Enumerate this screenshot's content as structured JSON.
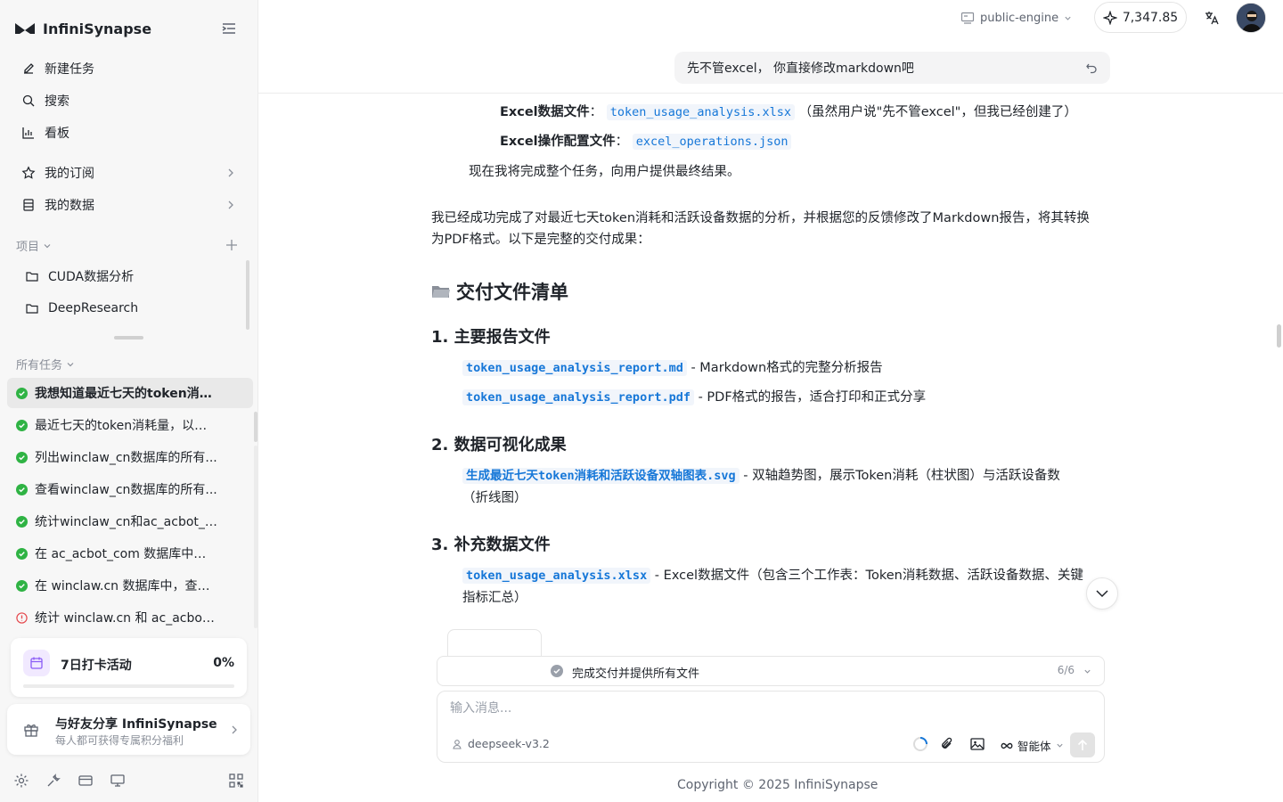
{
  "brand": {
    "name": "InfiniSynapse"
  },
  "nav": {
    "new_task": "新建任务",
    "search": "搜索",
    "board": "看板",
    "subscriptions": "我的订阅",
    "my_data": "我的数据"
  },
  "projects": {
    "label": "项目",
    "items": [
      {
        "label": "CUDA数据分析"
      },
      {
        "label": "DeepResearch"
      }
    ]
  },
  "tasks": {
    "label": "所有任务",
    "items": [
      {
        "label": "我想知道最近七天的token消耗...",
        "status": "done",
        "active": true
      },
      {
        "label": "最近七天的token消耗量，以及...",
        "status": "done"
      },
      {
        "label": "列出winclaw_cn数据库的所有...",
        "status": "done"
      },
      {
        "label": "查看winclaw_cn数据库的所有...",
        "status": "done"
      },
      {
        "label": "统计winclaw_cn和ac_acbot_c...",
        "status": "done"
      },
      {
        "label": "在 ac_acbot_com 数据库中，...",
        "status": "done"
      },
      {
        "label": "在 winclaw.cn 数据库中，查询...",
        "status": "done"
      },
      {
        "label": "统计 winclaw.cn 和 ac_acbot_...",
        "status": "error"
      }
    ]
  },
  "checkin": {
    "title": "7日打卡活动",
    "percent_label": "0%",
    "progress": 0
  },
  "share": {
    "title": "与好友分享 InfiniSynapse",
    "subtitle": "每人都可获得专属积分福利"
  },
  "topbar": {
    "engine": "public-engine",
    "points": "7,347.85"
  },
  "user_message": "先不管excel， 你直接修改markdown吧",
  "content": {
    "line1_label": "Excel数据文件",
    "line1_code": "token_usage_analysis.xlsx",
    "line1_note": "（虽然用户说\"先不管excel\"，但我已经创建了）",
    "line2_label": "Excel操作配置文件",
    "line2_code": "excel_operations.json",
    "line3": "现在我将完成整个任务，向用户提供最终结果。",
    "summary_1": "我已经成功完成了对最近七天token消耗和活跃设备数据的分析，并根据您的反馈修改了Markdown报告，将其转换",
    "summary_2": "为PDF格式。以下是完整的交付成果：",
    "h2": "交付文件清单",
    "s1_title": "1. 主要报告文件",
    "s1_item1_code": "token_usage_analysis_report.md",
    "s1_item1_text": " - Markdown格式的完整分析报告",
    "s1_item2_code": "token_usage_analysis_report.pdf",
    "s1_item2_text": " - PDF格式的报告，适合打印和正式分享",
    "s2_title": "2. 数据可视化成果",
    "s2_item1_code": "生成最近七天token消耗和活跃设备双轴图表.svg",
    "s2_item1_text": " - 双轴趋势图，展示Token消耗（柱状图）与活跃设备数",
    "s2_item1_text2": "（折线图）",
    "s3_title": "3. 补充数据文件",
    "s3_item1_code": "token_usage_analysis.xlsx",
    "s3_item1_text": " - Excel数据文件（包含三个工作表：Token消耗数据、活跃设备数据、关键",
    "s3_item1_text2": "指标汇总）"
  },
  "progress": {
    "text": "完成交付并提供所有文件",
    "count": "6/6"
  },
  "composer": {
    "placeholder": "输入消息...",
    "model": "deepseek-v3.2",
    "agent": "智能体"
  },
  "footer": {
    "copyright": "Copyright © 2025 InfiniSynapse"
  },
  "colors": {
    "accent": "#1677d8",
    "success": "#2fb344",
    "error": "#e5484d",
    "brand_purple": "#8b5cf6"
  }
}
